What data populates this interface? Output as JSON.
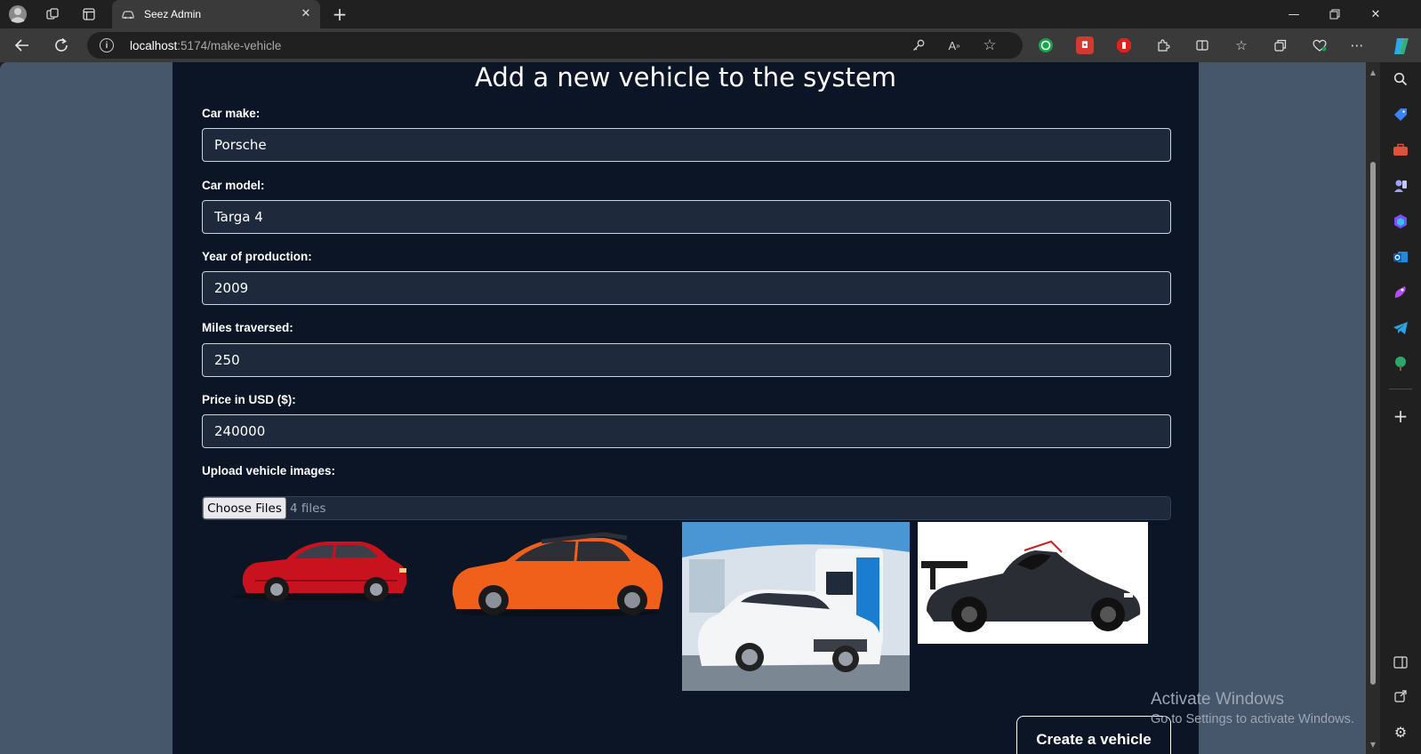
{
  "browser": {
    "tab_title": "Seez Admin",
    "url_host": "localhost",
    "url_path": ":5174/make-vehicle",
    "icons": {
      "profile": "profile-icon",
      "workspaces": "workspaces-icon",
      "tab_actions": "tab-actions-icon",
      "back": "back-arrow-icon",
      "refresh": "refresh-icon",
      "info": "site-info-icon",
      "password": "password-key-icon",
      "read_aloud": "read-aloud-icon",
      "favorite": "favorite-star-icon"
    },
    "accent": "#0078d4"
  },
  "page": {
    "title": "Add a new vehicle to the system",
    "fields": [
      {
        "label": "Car make:",
        "value": "Porsche"
      },
      {
        "label": "Car model:",
        "value": "Targa 4"
      },
      {
        "label": "Year of production:",
        "value": "2009"
      },
      {
        "label": "Miles traversed:",
        "value": "250"
      },
      {
        "label": "Price in USD ($):",
        "value": "240000"
      }
    ],
    "upload": {
      "label": "Upload vehicle images:",
      "button": "Choose Files",
      "count": "4 files"
    },
    "images": [
      "red-hatchback-car",
      "orange-hatchback-car",
      "white-sedan-at-charging-station",
      "black-race-car"
    ],
    "submit": "Create a vehicle",
    "colors": {
      "panel": "#0b1526",
      "background": "#46566b",
      "input_bg": "#1e293b"
    }
  },
  "watermark": {
    "line1": "Activate Windows",
    "line2": "Go to Settings to activate Windows."
  }
}
